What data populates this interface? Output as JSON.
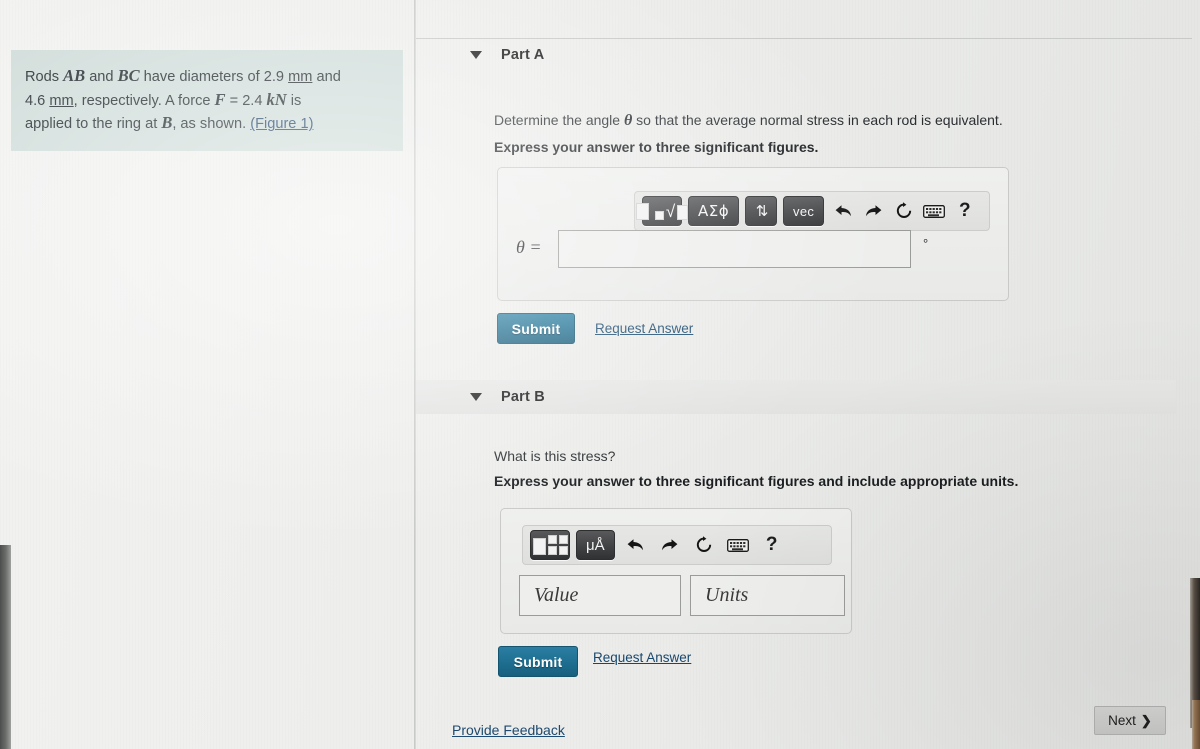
{
  "question": {
    "line1_pre": "Rods ",
    "ab": "AB",
    "line1_mid": " and ",
    "bc": "BC",
    "line1_post": " have diameters of 2.9 ",
    "unit_mm1": "mm",
    "line1_end": " and",
    "line2_pre": "4.6 ",
    "unit_mm2": "mm",
    "line2_mid": ", respectively. A force ",
    "force_sym": "F",
    "force_eq": " = 2.4 ",
    "force_unit": "kN",
    "line2_end": " is",
    "line3": "applied to the ring at ",
    "b_sym": "B",
    "line3_end": ", as shown. ",
    "figure_link": "(Figure 1)"
  },
  "part_a": {
    "title": "Part A",
    "caret_icon": "caret-down-icon",
    "prompt_pre": "Determine the angle ",
    "prompt_theta": "θ",
    "prompt_post": " so that the average normal stress in each rod is equivalent.",
    "instruction": "Express your answer to three significant figures.",
    "toolbar": {
      "template_button": "math-template",
      "greek_button": "ΑΣϕ",
      "sort_button": "⇅",
      "vec_button": "vec",
      "undo_icon": "undo-icon",
      "redo_icon": "redo-icon",
      "reset_icon": "reset-icon",
      "keyboard_icon": "keyboard-icon",
      "help_icon": "help-icon",
      "undo_glyph": "↩",
      "redo_glyph": "↪",
      "reset_glyph": "↺",
      "keyboard_glyph": "⌨",
      "help_glyph": "?"
    },
    "equation_label": "θ =",
    "input_value": "",
    "input_placeholder": "",
    "degree_unit": "°",
    "submit_label": "Submit",
    "request_answer_label": "Request Answer"
  },
  "part_b": {
    "title": "Part B",
    "caret_icon": "caret-down-icon",
    "prompt": "What is this stress?",
    "instruction": "Express your answer to three significant figures and include appropriate units.",
    "toolbar": {
      "template_button": "math-template",
      "units_button": "μÅ",
      "undo_glyph": "↩",
      "redo_glyph": "↪",
      "reset_glyph": "↺",
      "keyboard_glyph": "⌨",
      "help_glyph": "?"
    },
    "value_placeholder": "Value",
    "value_input": "",
    "units_placeholder": "Units",
    "units_input": "",
    "submit_label": "Submit",
    "request_answer_label": "Request Answer"
  },
  "footer": {
    "feedback_label": "Provide Feedback",
    "next_label": "Next",
    "next_chevron": "❯"
  },
  "colors": {
    "question_box_bg": "#cfdcd9",
    "submit_bg": "#1e6e90",
    "link": "#18486e",
    "page_bg": "#eeeeec"
  }
}
